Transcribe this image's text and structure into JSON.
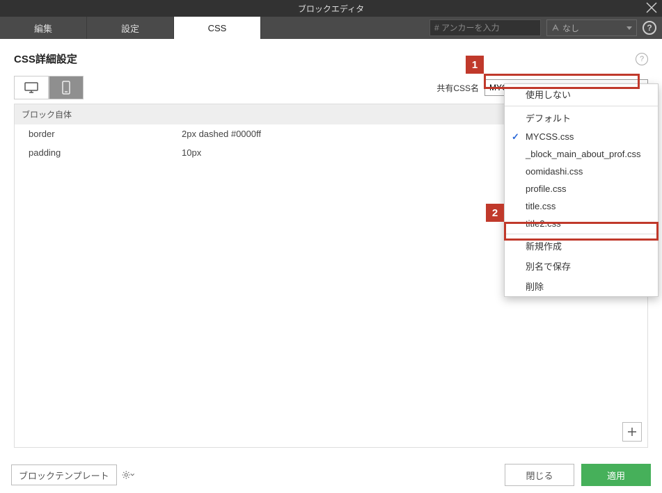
{
  "window": {
    "title": "ブロックエディタ"
  },
  "tabs": {
    "edit": "編集",
    "settings": "設定",
    "css": "CSS"
  },
  "anchor": {
    "placeholder": "# アンカーを入力"
  },
  "font_select": {
    "label": "なし"
  },
  "section": {
    "title": "CSS詳細設定"
  },
  "shared_css": {
    "label": "共有CSS名",
    "value": "MYCSS"
  },
  "group": {
    "title": "ブロック自体"
  },
  "props": [
    {
      "name": "border",
      "value": "2px dashed #0000ff"
    },
    {
      "name": "padding",
      "value": "10px"
    }
  ],
  "dropdown": {
    "opt_none": "使用しない",
    "opt_default": "デフォルト",
    "opt_mycss": "MYCSS.css",
    "opt_block": "_block_main_about_prof.css",
    "opt_oomidashi": "oomidashi.css",
    "opt_profile": "profile.css",
    "opt_title": "title.css",
    "opt_title2": "title2.css",
    "opt_new": "新規作成",
    "opt_saveas": "別名で保存",
    "opt_delete": "削除"
  },
  "footer": {
    "template": "ブロックテンプレート",
    "close": "閉じる",
    "apply": "適用"
  },
  "callouts": {
    "c1": "1",
    "c2": "2"
  }
}
